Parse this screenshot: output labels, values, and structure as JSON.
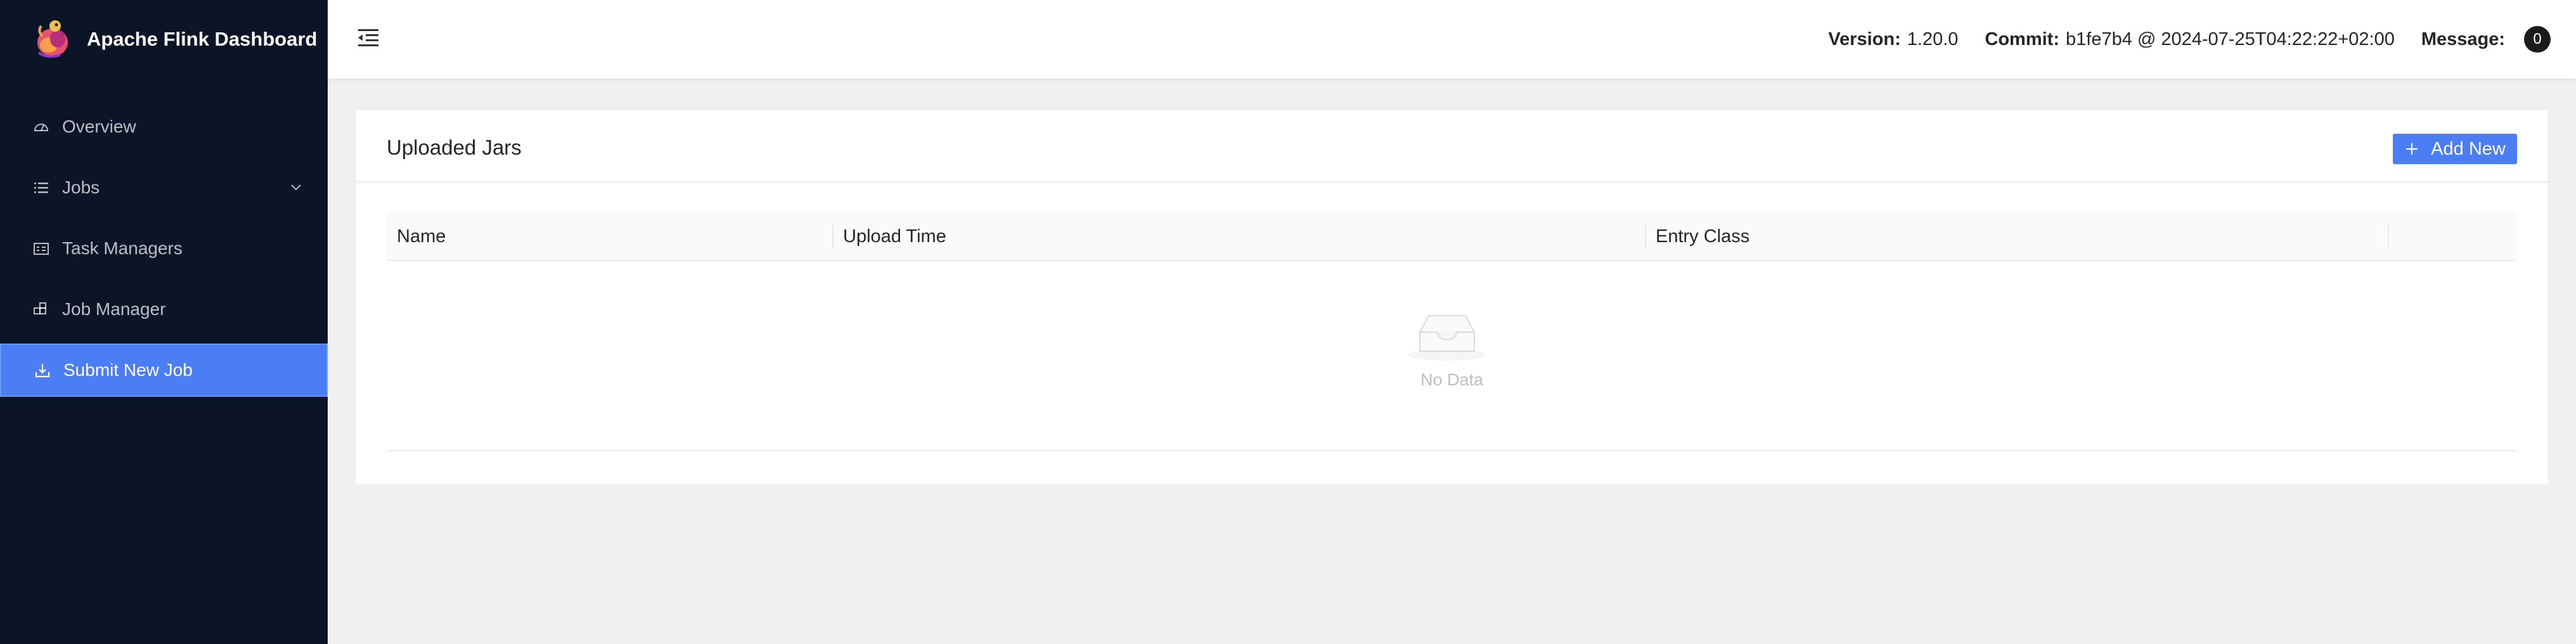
{
  "app": {
    "title": "Apache Flink Dashboard"
  },
  "sidebar": {
    "items": [
      {
        "label": "Overview",
        "icon": "dashboard-icon"
      },
      {
        "label": "Jobs",
        "icon": "list-icon",
        "expandable": true
      },
      {
        "label": "Task Managers",
        "icon": "schedule-icon"
      },
      {
        "label": "Job Manager",
        "icon": "build-icon"
      },
      {
        "label": "Submit New Job",
        "icon": "upload-icon",
        "active": true
      }
    ]
  },
  "header": {
    "version_label": "Version:",
    "version_value": "1.20.0",
    "commit_label": "Commit:",
    "commit_value": "b1fe7b4 @ 2024-07-25T04:22:22+02:00",
    "message_label": "Message:",
    "message_count": "0"
  },
  "card": {
    "title": "Uploaded Jars",
    "add_button": "Add New"
  },
  "table": {
    "columns": [
      "Name",
      "Upload Time",
      "Entry Class",
      ""
    ],
    "rows": [],
    "empty_text": "No Data"
  },
  "colors": {
    "sidebar_bg": "#0c1528",
    "accent": "#4b7df5",
    "page_bg": "#f0f0f0"
  }
}
